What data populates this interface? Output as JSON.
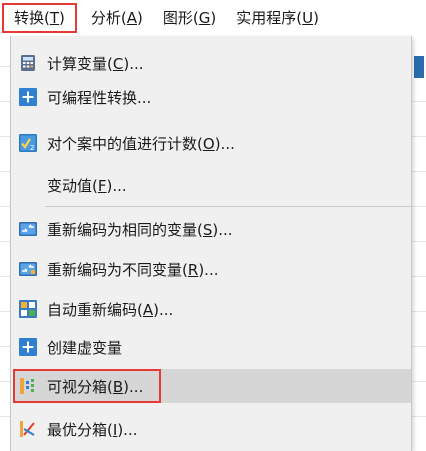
{
  "menubar": {
    "items": [
      {
        "label": "转换",
        "mnemonic": "T"
      },
      {
        "label": "分析",
        "mnemonic": "A"
      },
      {
        "label": "图形",
        "mnemonic": "G"
      },
      {
        "label": "实用程序",
        "mnemonic": "U"
      }
    ]
  },
  "transform_menu": {
    "items": [
      {
        "label": "计算变量",
        "mnemonic": "C",
        "suffix": "...",
        "icon": "calculator-icon"
      },
      {
        "label": "可编程性转换",
        "mnemonic": "",
        "suffix": "...",
        "icon": "plus-icon"
      },
      {
        "label": "对个案中的值进行计数",
        "mnemonic": "O",
        "suffix": "...",
        "icon": "count-values-icon"
      },
      {
        "label": "变动值",
        "mnemonic": "F",
        "suffix": "...",
        "icon": ""
      },
      {
        "label": "重新编码为相同的变量",
        "mnemonic": "S",
        "suffix": "...",
        "icon": "recode-same-icon"
      },
      {
        "label": "重新编码为不同变量",
        "mnemonic": "R",
        "suffix": "...",
        "icon": "recode-different-icon"
      },
      {
        "label": "自动重新编码",
        "mnemonic": "A",
        "suffix": "...",
        "icon": "automatic-recode-icon"
      },
      {
        "label": "创建虚变量",
        "mnemonic": "",
        "suffix": "",
        "icon": "plus-icon"
      },
      {
        "label": "可视分箱",
        "mnemonic": "B",
        "suffix": "...",
        "icon": "visual-binning-icon"
      },
      {
        "label": "最优分箱",
        "mnemonic": "I",
        "suffix": "...",
        "icon": "optimal-binning-icon"
      }
    ]
  },
  "colors": {
    "highlight_border": "#e53935",
    "menu_background": "#f0f0f0",
    "hover_background": "#d6d6d6",
    "icon_blue": "#2f80d1"
  }
}
